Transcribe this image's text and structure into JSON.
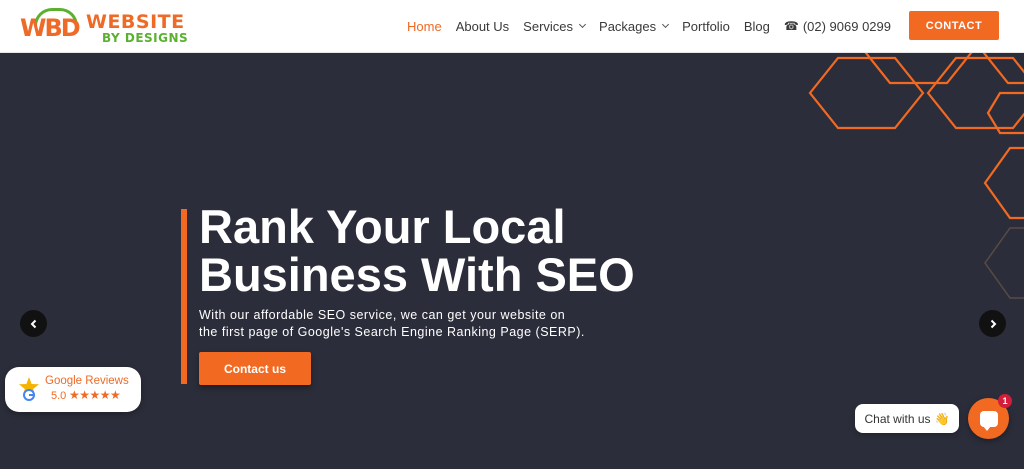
{
  "logo": {
    "mark": "WBD",
    "word1": "WEBSITE",
    "word2": "BY DESIGNS"
  },
  "nav": {
    "items": [
      {
        "label": "Home",
        "active": true,
        "dropdown": false
      },
      {
        "label": "About Us",
        "active": false,
        "dropdown": false
      },
      {
        "label": "Services",
        "active": false,
        "dropdown": true
      },
      {
        "label": "Packages",
        "active": false,
        "dropdown": true
      },
      {
        "label": "Portfolio",
        "active": false,
        "dropdown": false
      },
      {
        "label": "Blog",
        "active": false,
        "dropdown": false
      }
    ],
    "phone": "(02) 9069 0299",
    "phone_icon": "phone-icon",
    "contact_label": "CONTACT"
  },
  "hero": {
    "title_line1": "Rank Your Local",
    "title_line2": "Business With SEO",
    "subtitle_line1": "With our affordable SEO service, we can get your website on",
    "subtitle_line2": "the first page of Google's Search Engine Ranking Page (SERP).",
    "button_label": "Contact us"
  },
  "reviews": {
    "title": "Google Reviews",
    "score": "5.0",
    "stars": "★★★★★",
    "rating": 5
  },
  "chat": {
    "label": "Chat with us",
    "emoji": "👋",
    "badge": "1"
  },
  "colors": {
    "accent": "#f26a22",
    "green": "#5bb12f",
    "background": "#2b2d3a",
    "badge": "#d21d3b"
  }
}
